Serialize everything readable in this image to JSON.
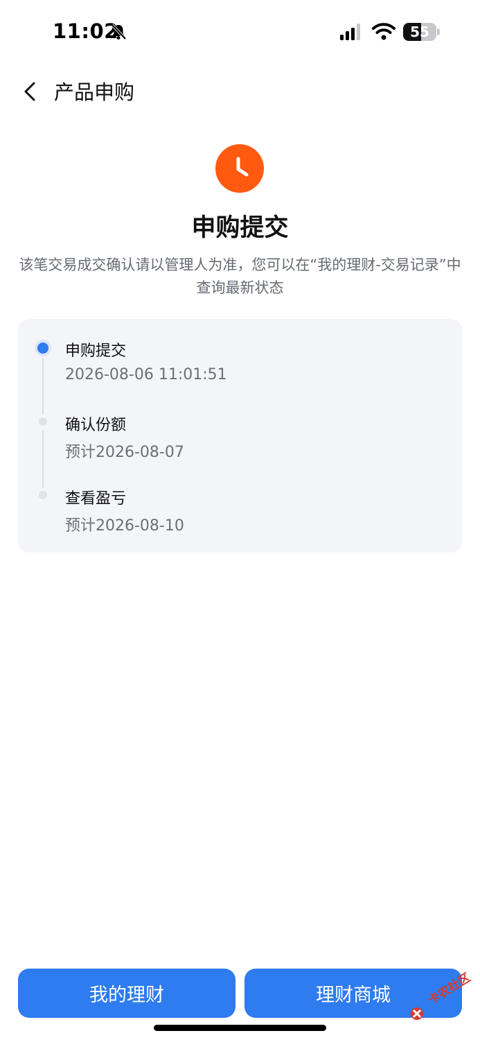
{
  "status_bar": {
    "time": "11:02",
    "battery": "55",
    "battery_level": 0.55,
    "icons": [
      "bell-slash-icon",
      "cellular-signal-icon",
      "wifi-icon",
      "battery-icon"
    ]
  },
  "nav": {
    "back_icon": "chevron-left-icon",
    "title": "产品申购"
  },
  "result": {
    "icon": "clock-icon",
    "accent_color": "#ff5a10",
    "title": "申购提交",
    "description": "该笔交易成交确认请以管理人为准，您可以在“我的理财-交易记录”中查询最新状态"
  },
  "timeline": {
    "steps": [
      {
        "title": "申购提交",
        "subtitle": "2026-08-06 11:01:51",
        "state": "active"
      },
      {
        "title": "确认份额",
        "subtitle": "预计2026-08-07",
        "state": "pending"
      },
      {
        "title": "查看盈亏",
        "subtitle": "预计2026-08-10",
        "state": "pending"
      }
    ],
    "active_color": "#2f7bf0"
  },
  "buttons": {
    "left_label": "我的理财",
    "right_label": "理财商城",
    "color": "#2f7bf0"
  },
  "watermark": {
    "text": "卡农社区"
  }
}
